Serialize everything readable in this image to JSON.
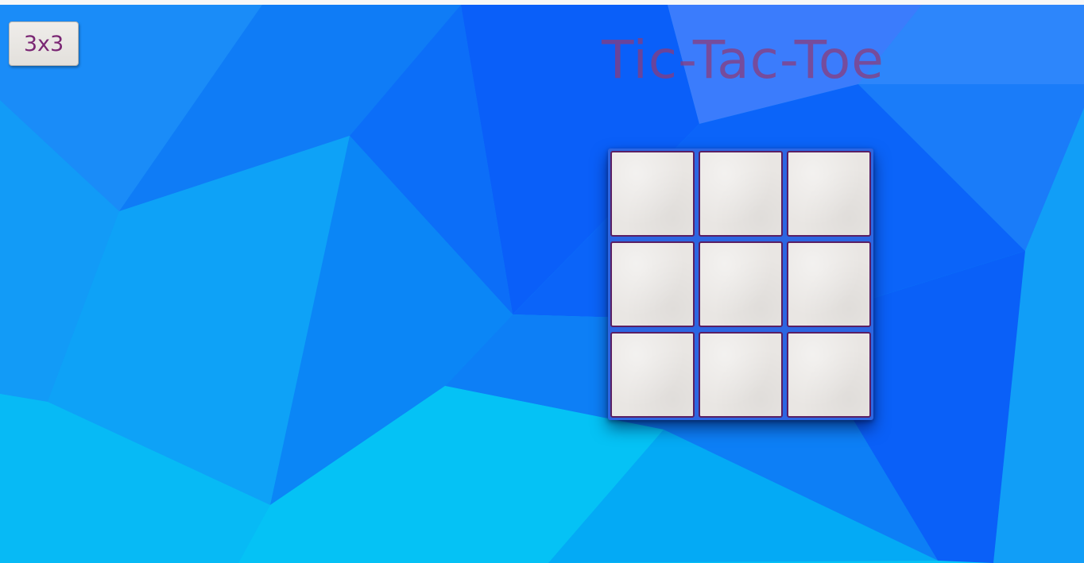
{
  "header": {
    "size_button_label": "3x3",
    "title": "Tic-Tac-Toe"
  },
  "board": {
    "size": "3x3",
    "cells": [
      "",
      "",
      "",
      "",
      "",
      "",
      "",
      "",
      ""
    ]
  },
  "colors": {
    "title": "#8e3a78",
    "button_text": "#7a2673",
    "cell_fill": "#e9e6e3",
    "cell_border": "#5a1f64",
    "board_frame": "#2c66e2",
    "background_light": "#06c6f5",
    "background_dark": "#0b4ef8"
  }
}
